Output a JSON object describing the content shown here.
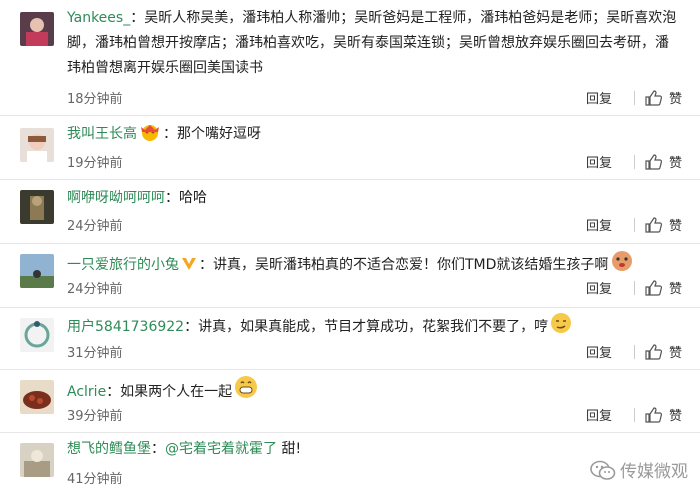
{
  "comments": [
    {
      "user": "Yankees_",
      "text": "：吴昕人称吴美，潘玮柏人称潘帅；吴昕爸妈是工程师，潘玮柏爸妈是老师；吴昕喜欢泡脚，潘玮柏曾想开按摩店；潘玮柏喜欢吃，吴昕有泰国菜连锁；吴昕曾想放弃娱乐圈回去考研，潘玮柏曾想离开娱乐圈回美国读书",
      "time": "18分钟前"
    },
    {
      "user": "我叫王长高",
      "text": "：那个嘴好逗呀",
      "time": "19分钟前"
    },
    {
      "user": "啊咿呀呦呵呵呵",
      "text": "：哈哈",
      "time": "24分钟前"
    },
    {
      "user": "一只爱旅行的小兔",
      "text": "：讲真，吴昕潘玮柏真的不适合恋爱！你们TMD就该结婚生孩子啊",
      "time": "24分钟前"
    },
    {
      "user": "用户5841736922",
      "text": "：讲真，如果真能成，节目才算成功，花絮我们不要了，哼",
      "time": "31分钟前"
    },
    {
      "user": "Aclrie",
      "text": "：如果两个人在一起",
      "time": "39分钟前"
    },
    {
      "user": "想飞的鳕鱼堡",
      "mention": "@宅着宅着就霍了",
      "text": " 甜!",
      "sep": "：",
      "time": "41分钟前"
    }
  ],
  "actions": {
    "reply": "回复",
    "like": "赞"
  },
  "watermark": "传媒微观",
  "colors": {
    "username": "#2e8b57",
    "divider": "#e6e6e6"
  }
}
